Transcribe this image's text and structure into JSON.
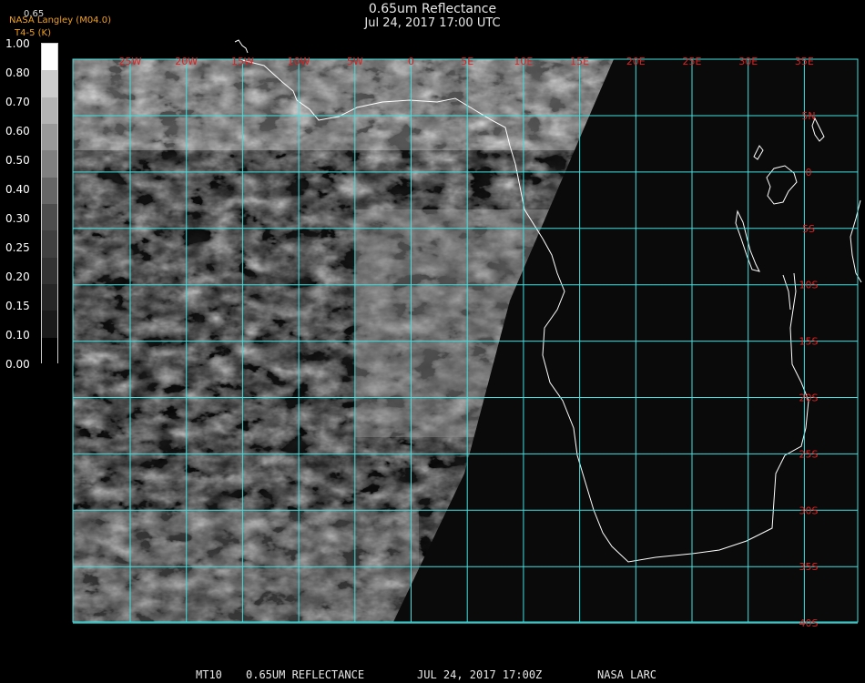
{
  "header": {
    "title": "0.65um Reflectance",
    "subtitle": "Jul 24, 2017 17:00 UTC",
    "credit": "NASA Langley (M04.0)",
    "credit_sub": "T4-5 (K)",
    "corner_value": "0.65"
  },
  "legend": {
    "labels": [
      "1.00",
      "0.80",
      "0.70",
      "0.60",
      "0.50",
      "0.40",
      "0.30",
      "0.25",
      "0.20",
      "0.15",
      "0.10",
      "0.00"
    ],
    "values": [
      1.0,
      0.8,
      0.7,
      0.6,
      0.5,
      0.4,
      0.3,
      0.25,
      0.2,
      0.15,
      0.1,
      0.0
    ]
  },
  "map": {
    "lon_labels": [
      "25W",
      "20W",
      "15W",
      "10W",
      "5W",
      "0",
      "5E",
      "10E",
      "15E",
      "20E",
      "25E",
      "30E",
      "35E"
    ],
    "lat_labels": [
      "5N",
      "0",
      "5S",
      "10S",
      "15S",
      "20S",
      "25S",
      "30S",
      "35S",
      "40S"
    ],
    "colors": {
      "grid": "#40e0e0",
      "label": "#e02020",
      "coast": "#ffffff",
      "space": "#0a0a0a"
    }
  },
  "footer": {
    "product": "MT10",
    "band": "0.65UM REFLECTANCE",
    "datetime": "JUL 24, 2017 17:00Z",
    "source": "NASA LARC"
  }
}
